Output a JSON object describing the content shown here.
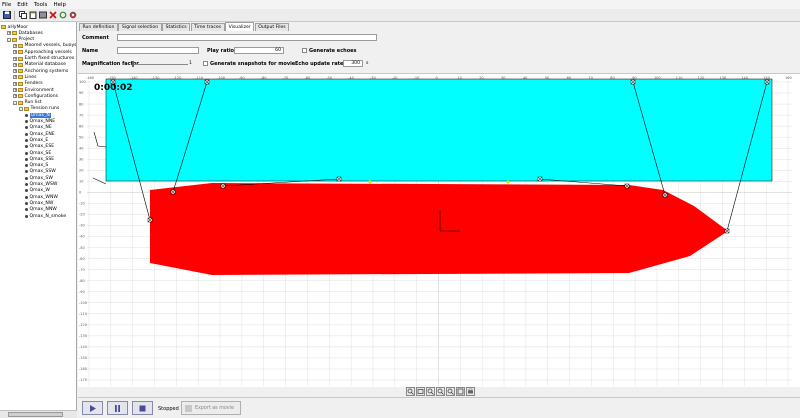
{
  "menu": [
    "File",
    "Edit",
    "Tools",
    "Help"
  ],
  "tree": {
    "items": [
      {
        "label": "aHyMoor",
        "level": 0,
        "kind": "folder",
        "exp": ""
      },
      {
        "label": "Databases",
        "level": 1,
        "kind": "folder",
        "exp": "+"
      },
      {
        "label": "Project",
        "level": 1,
        "kind": "folder",
        "exp": "-"
      },
      {
        "label": "Moored vessels, buoys",
        "level": 2,
        "kind": "folder",
        "exp": "+"
      },
      {
        "label": "Approaching vessels",
        "level": 2,
        "kind": "folder",
        "exp": "+"
      },
      {
        "label": "Earth fixed structures",
        "level": 2,
        "kind": "folder",
        "exp": "+"
      },
      {
        "label": "Material database",
        "level": 2,
        "kind": "folder",
        "exp": "+"
      },
      {
        "label": "Anchoring systems",
        "level": 2,
        "kind": "folder",
        "exp": "+"
      },
      {
        "label": "Lines",
        "level": 2,
        "kind": "folder",
        "exp": "+"
      },
      {
        "label": "Fenders",
        "level": 2,
        "kind": "folder",
        "exp": "+"
      },
      {
        "label": "Environment",
        "level": 2,
        "kind": "folder",
        "exp": "+"
      },
      {
        "label": "Configurations",
        "level": 2,
        "kind": "folder",
        "exp": "+"
      },
      {
        "label": "Run list",
        "level": 2,
        "kind": "folder",
        "exp": "-"
      },
      {
        "label": "Tension runs",
        "level": 3,
        "kind": "folder",
        "exp": "-"
      },
      {
        "label": "Qmax_N",
        "level": 4,
        "kind": "leaf",
        "sel": true
      },
      {
        "label": "Qmax_NNE",
        "level": 4,
        "kind": "leaf"
      },
      {
        "label": "Qmax_NE",
        "level": 4,
        "kind": "leaf"
      },
      {
        "label": "Qmax_ENE",
        "level": 4,
        "kind": "leaf"
      },
      {
        "label": "Qmax_E",
        "level": 4,
        "kind": "leaf"
      },
      {
        "label": "Qmax_ESE",
        "level": 4,
        "kind": "leaf"
      },
      {
        "label": "Qmax_SE",
        "level": 4,
        "kind": "leaf"
      },
      {
        "label": "Qmax_SSE",
        "level": 4,
        "kind": "leaf"
      },
      {
        "label": "Qmax_S",
        "level": 4,
        "kind": "leaf"
      },
      {
        "label": "Qmax_SSW",
        "level": 4,
        "kind": "leaf"
      },
      {
        "label": "Qmax_SW",
        "level": 4,
        "kind": "leaf"
      },
      {
        "label": "Qmax_WSW",
        "level": 4,
        "kind": "leaf"
      },
      {
        "label": "Qmax_W",
        "level": 4,
        "kind": "leaf"
      },
      {
        "label": "Qmax_WNW",
        "level": 4,
        "kind": "leaf"
      },
      {
        "label": "Qmax_NW",
        "level": 4,
        "kind": "leaf"
      },
      {
        "label": "Qmax_NNW",
        "level": 4,
        "kind": "leaf"
      },
      {
        "label": "Qmax_N_smoke",
        "level": 4,
        "kind": "leaf"
      }
    ]
  },
  "tabs": [
    "Run definition",
    "Signal selection",
    "Statistics",
    "Time traces",
    "Visualizer",
    "Output Files"
  ],
  "active_tab": 4,
  "form": {
    "comment_label": "Comment",
    "comment_value": "",
    "name_label": "Name",
    "name_value": "",
    "play_ratio_label": "Play ratio",
    "play_ratio_value": "60",
    "echoes_label": "Generate echoes",
    "magnification_label": "Magnification factor",
    "magnification_value": "1",
    "snapshots_label": "Generate snapshots for movie",
    "echo_rate_label": "Echo update rate",
    "echo_rate_value": "300",
    "echo_rate_unit": "s"
  },
  "visualizer": {
    "time": "0:00:02",
    "x_ticks": [
      "-160",
      "-150",
      "-140",
      "-130",
      "-120",
      "-110",
      "-100",
      "-90",
      "-80",
      "-70",
      "-60",
      "-50",
      "-40",
      "-30",
      "-20",
      "-10",
      "0",
      "10",
      "20",
      "30",
      "40",
      "50",
      "60",
      "70",
      "80",
      "90",
      "100",
      "110",
      "120",
      "130",
      "140",
      "150",
      "160"
    ],
    "y_ticks": [
      "100",
      "90",
      "80",
      "70",
      "60",
      "50",
      "40",
      "30",
      "20",
      "10",
      "0",
      "-10",
      "-20",
      "-30",
      "-40",
      "-50",
      "-60",
      "-70",
      "-80",
      "-90",
      "-100",
      "-110",
      "-120",
      "-130",
      "-140",
      "-150",
      "-160",
      "-170"
    ],
    "colors": {
      "quay": "#00ffff",
      "vessel": "#ff0000",
      "lines": "#000000",
      "fenders": "#e8d800",
      "grid": "#d8d8d8"
    }
  },
  "zoom_icons": [
    "zoom-in-icon",
    "zoom-out-icon",
    "zoom-fit-icon",
    "zoom-window-icon",
    "pan-icon",
    "reset-view-icon",
    "print-icon"
  ],
  "controls": {
    "status": "Stopped",
    "export_label": "Export as movie"
  }
}
